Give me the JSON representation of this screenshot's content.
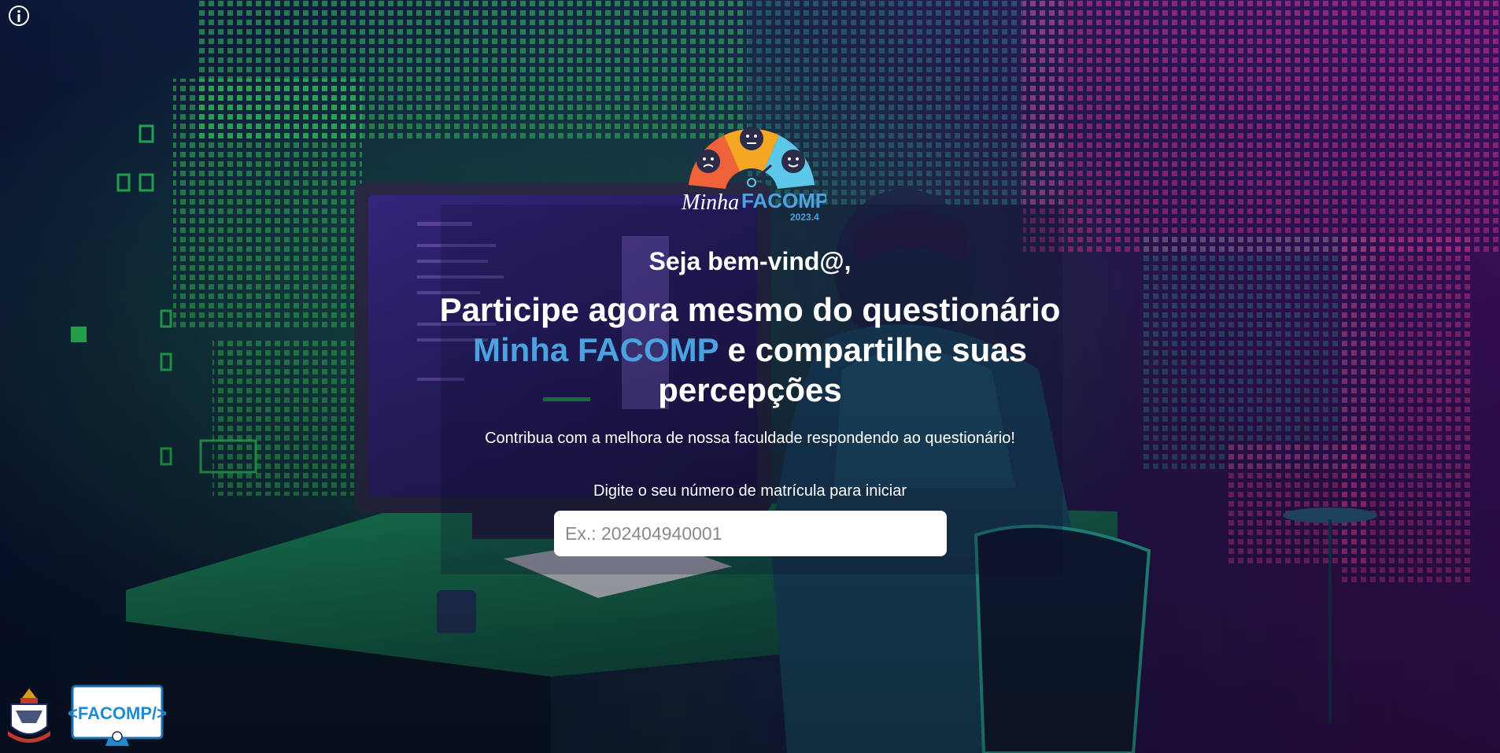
{
  "brand": {
    "logo_text_minha": "Minha",
    "logo_text_facomp": "FACOMP",
    "logo_version": "2023.4"
  },
  "hero": {
    "greeting": "Seja bem-vind@,",
    "headline_part1": "Participe agora mesmo do questionário",
    "headline_accent": "Minha FACOMP",
    "headline_part2": "e compartilhe suas percepções",
    "subtext": "Contribua com a melhora de nossa faculdade respondendo ao questionário!"
  },
  "form": {
    "label": "Digite o seu número de matrícula para iniciar",
    "placeholder": "Ex.: 202404940001",
    "value": ""
  },
  "footer": {
    "facomp_logo_text": "<FACOMP/>"
  },
  "icons": {
    "info": "info-icon"
  },
  "colors": {
    "accent_blue": "#4aa3e0",
    "background": "#0b0b2c",
    "matrix_green": "#2ec95a",
    "matrix_pink": "#c8328f"
  }
}
